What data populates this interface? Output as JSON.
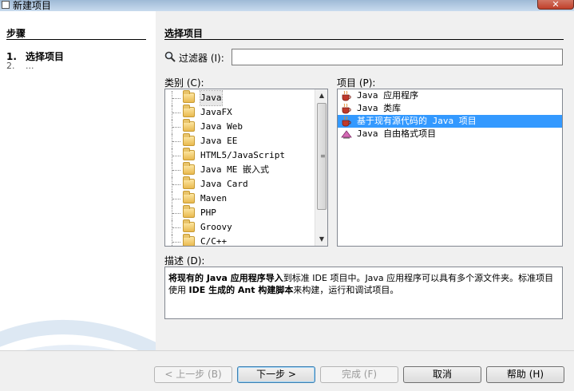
{
  "window": {
    "title": "新建项目",
    "close_glyph": "✕"
  },
  "steps": {
    "title": "步骤",
    "items": [
      {
        "num": "1.",
        "label": "选择项目"
      },
      {
        "num": "2.",
        "label": "..."
      }
    ]
  },
  "main": {
    "title": "选择项目",
    "filter": {
      "label": "过滤器 (I):",
      "value": "",
      "placeholder": ""
    },
    "categories": {
      "label": "类别 (C):",
      "items": [
        "Java",
        "JavaFX",
        "Java Web",
        "Java EE",
        "HTML5/JavaScript",
        "Java ME 嵌入式",
        "Java Card",
        "Maven",
        "PHP",
        "Groovy",
        "C/C++"
      ],
      "selected_index": 0
    },
    "projects": {
      "label": "项目 (P):",
      "items": [
        {
          "label": "Java 应用程序",
          "icon": "java-cup-icon"
        },
        {
          "label": "Java 类库",
          "icon": "java-cup-icon"
        },
        {
          "label": "基于现有源代码的 Java 项目",
          "icon": "java-cup-icon"
        },
        {
          "label": "Java 自由格式项目",
          "icon": "freeform-project-icon"
        }
      ],
      "selected_index": 2
    },
    "description": {
      "label": "描述 (D):",
      "segments": [
        {
          "text": "将现有的 Java 应用程序导入",
          "bold": true
        },
        {
          "text": "到标准 IDE 项目中。Java 应用程序可以具有多个源文件夹。标准项目使用 ",
          "bold": false
        },
        {
          "text": "IDE 生成的 Ant 构建脚本",
          "bold": true
        },
        {
          "text": "来构建，运行和调试项目。",
          "bold": false
        }
      ]
    }
  },
  "buttons": {
    "back": "< 上一步 (B)",
    "next": "下一步 >",
    "finish": "完成 (F)",
    "cancel": "取消",
    "help": "帮助 (H)"
  },
  "colors": {
    "selection": "#3399ff",
    "panel_bg": "#f0f0f0",
    "steps_bg": "#ffffff"
  }
}
